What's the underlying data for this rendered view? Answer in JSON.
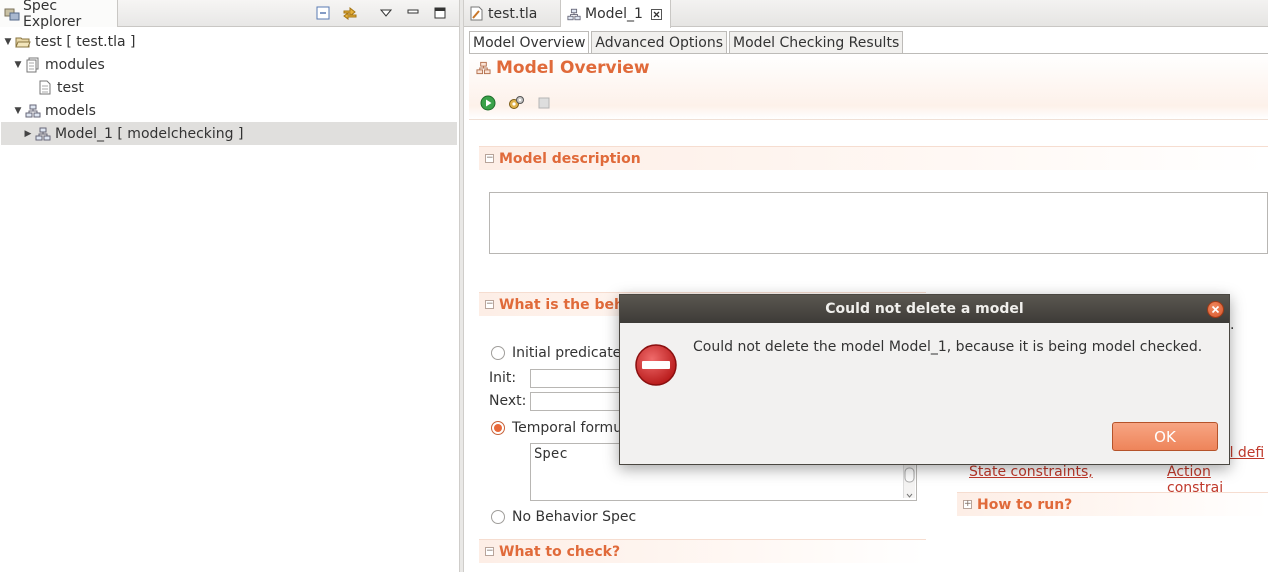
{
  "spec_explorer": {
    "tab_label": "Spec Explorer",
    "tree": [
      {
        "label": "test [ test.tla ]",
        "depth": 0,
        "expanded": true,
        "icon": "folder-open-icon"
      },
      {
        "label": "modules",
        "depth": 1,
        "expanded": true,
        "icon": "modules-icon"
      },
      {
        "label": "test",
        "depth": 2,
        "icon": "file-icon"
      },
      {
        "label": "models",
        "depth": 1,
        "expanded": true,
        "icon": "models-icon"
      },
      {
        "label": "Model_1 [ modelchecking ]",
        "depth": 2,
        "expanded": false,
        "selected": true,
        "icon": "model-icon"
      }
    ]
  },
  "editor": {
    "tabs": [
      {
        "label": "test.tla",
        "icon": "tla-file-icon",
        "active": false
      },
      {
        "label": "Model_1",
        "icon": "model-icon",
        "active": true,
        "closable": true
      }
    ],
    "page_tabs": [
      "Model Overview",
      "Advanced Options",
      "Model Checking Results"
    ],
    "active_page_tab": "Model Overview",
    "form_title": "Model Overview",
    "sections": {
      "model_description": "Model description",
      "behavior": "What is the beha",
      "what_to_check": "What to check?",
      "how_to_run": "How to run?"
    },
    "behavior": {
      "initial_predicate": "Initial predicate",
      "init_label": "Init:",
      "next_label": "Next:",
      "temporal_formula": "Temporal formu",
      "spec_value": "Spec",
      "no_behavior": "No Behavior Spec",
      "selected": "temporal"
    },
    "right_links": {
      "partial_definitions": "al defi",
      "state_constraints": "State constraints,",
      "action_constraints": "Action constrai",
      "dot": "."
    }
  },
  "dialog": {
    "title": "Could not delete a model",
    "message": "Could not delete the model Model_1, because it is being model checked.",
    "ok_label": "OK",
    "icon": "error-stop-icon"
  },
  "colors": {
    "accent": "#e06a3a",
    "link": "#c0392b",
    "dialog_title_bg": "#3d3b37",
    "ok_button": "#ee845a",
    "error_icon": "#cc2222"
  }
}
